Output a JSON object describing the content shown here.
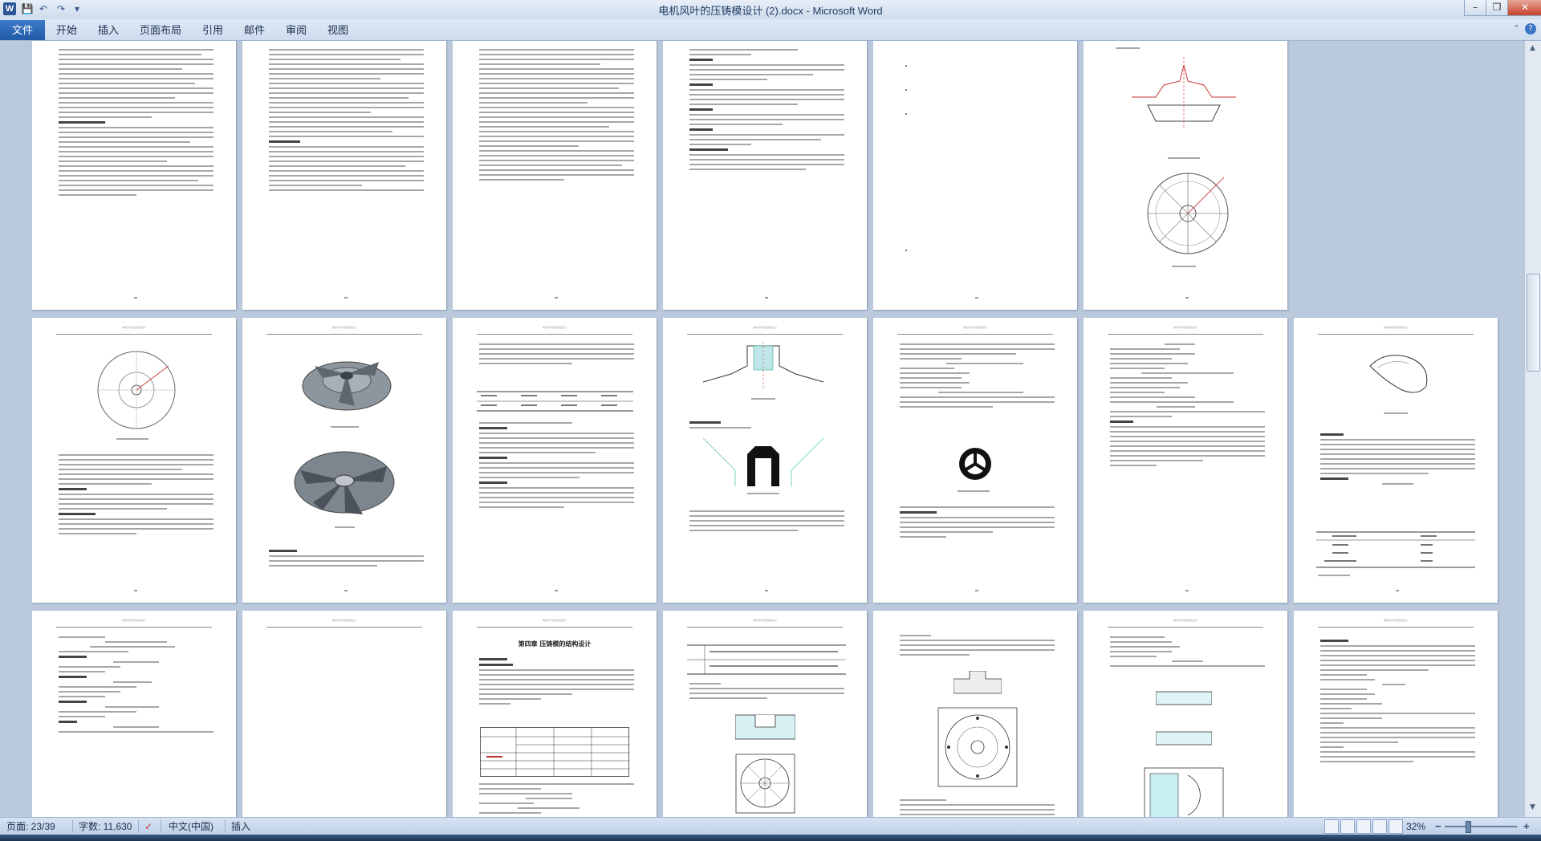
{
  "app": {
    "title": "电机风叶的压铸模设计 (2).docx  -  Microsoft Word",
    "logo_letter": "W"
  },
  "ribbon": {
    "tabs": [
      "文件",
      "开始",
      "插入",
      "页面布局",
      "引用",
      "邮件",
      "审阅",
      "视图"
    ]
  },
  "document": {
    "page_header_text": "电机风叶的压铸模设计",
    "chapter_title": "第四章  压铸模的结构设计"
  },
  "status": {
    "page": "页面: 23/39",
    "words": "字数: 11,630",
    "language": "中文(中国)",
    "mode": "插入",
    "zoom": "32%"
  },
  "colors": {
    "accent": "#2b5797",
    "file_tab": "#1f5aa6",
    "close_button": "#c4412b"
  }
}
